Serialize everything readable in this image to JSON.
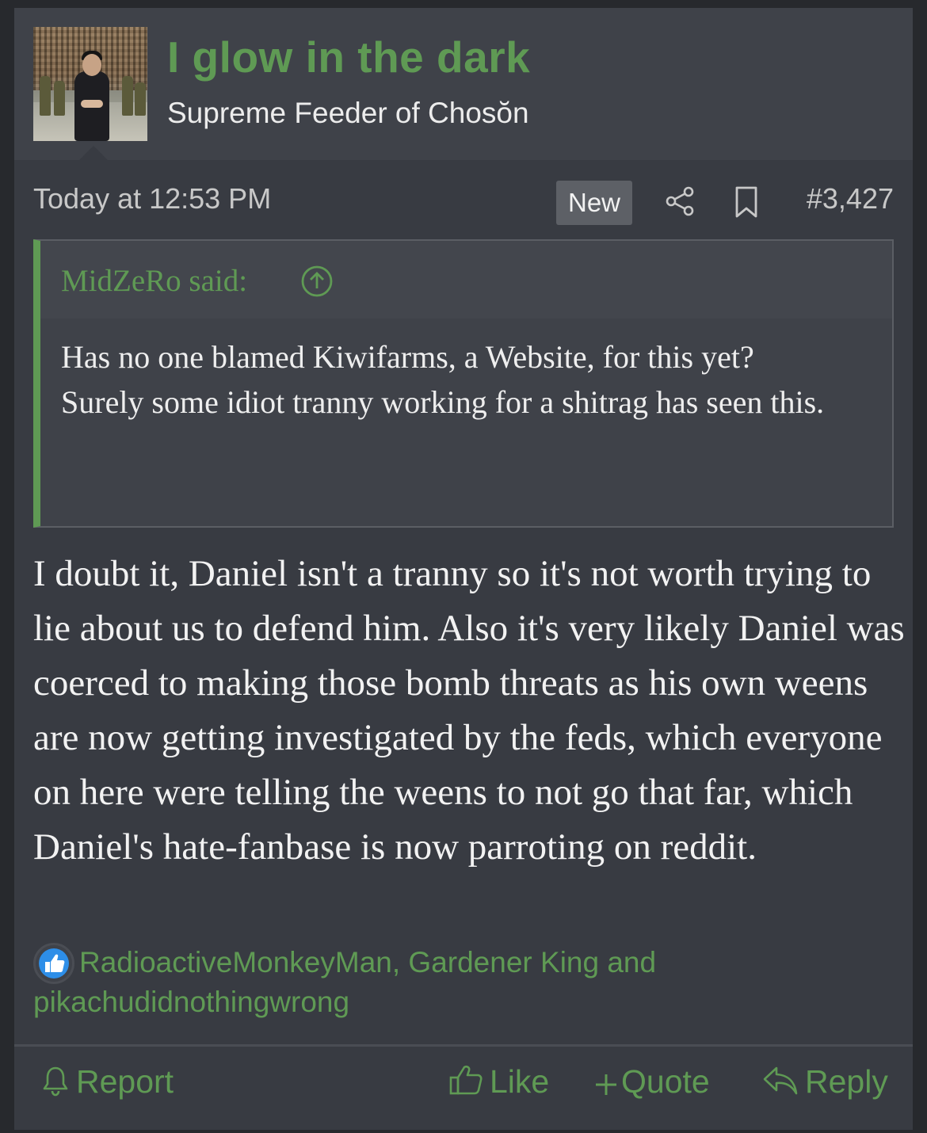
{
  "user": {
    "name": "I glow in the dark",
    "title": "Supreme Feeder of Chosŏn"
  },
  "meta": {
    "time": "Today at 12:53 PM",
    "new_badge": "New",
    "post_number": "#3,427"
  },
  "quote": {
    "author": "MidZeRo said:",
    "line1": "Has no one blamed Kiwifarms, a Website, for this yet?",
    "line2": "Surely some idiot tranny working for a shitrag has seen this."
  },
  "message": "I doubt it, Daniel isn't a tranny so it's not worth trying to lie about us to defend him. Also it's very likely Daniel was coerced to making those bomb threats as his own weens are now getting investigated by the feds, which everyone on here were telling the weens to not go that far, which Daniel's hate-fanbase is now parroting on reddit.",
  "reactions": {
    "text": "RadioactiveMonkeyMan, Gardener King and pikachudidnothingwrong"
  },
  "actions": {
    "report": "Report",
    "like": "Like",
    "quote": "Quote",
    "reply": "Reply"
  },
  "icons": {
    "share": "share-icon",
    "bookmark": "bookmark-icon",
    "quote_jump": "arrow-up-circle-icon",
    "reaction": "thumbs-up-icon",
    "report": "bell-icon",
    "like": "thumbs-up-icon",
    "quote": "plus-icon",
    "reply": "reply-icon"
  },
  "colors": {
    "accent": "#5f9a54",
    "background": "#383b42",
    "header": "#3f4249"
  }
}
